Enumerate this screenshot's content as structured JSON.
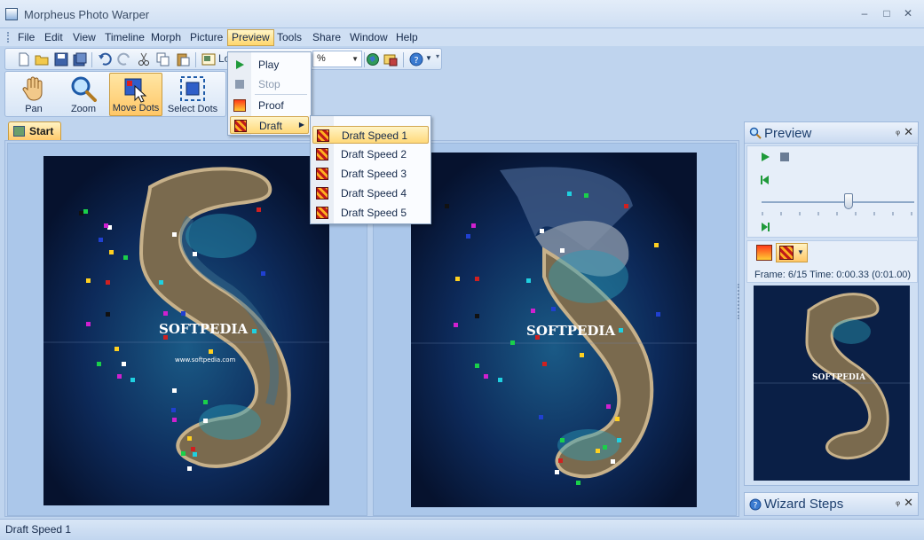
{
  "window": {
    "title": "Morpheus Photo Warper",
    "minimize": "–",
    "restore": "□",
    "close": "✕"
  },
  "menubar": {
    "items": [
      "File",
      "Edit",
      "View",
      "Timeline",
      "Morph",
      "Picture",
      "Preview",
      "Tools",
      "Share",
      "Window",
      "Help"
    ],
    "active": "Preview"
  },
  "toolbar": {
    "zoom_value": "%",
    "load_label": "Lo"
  },
  "bigbar": {
    "pan": "Pan",
    "zoom": "Zoom",
    "move_dots": "Move Dots",
    "select_dots": "Select Dots"
  },
  "document_tab": {
    "label": "Start"
  },
  "preview_menu": {
    "items": [
      {
        "label": "Play",
        "disabled": false
      },
      {
        "label": "Stop",
        "disabled": true
      },
      {
        "label": "Proof",
        "disabled": false
      },
      {
        "label": "Draft",
        "disabled": false,
        "has_submenu": true
      }
    ]
  },
  "draft_submenu": {
    "items": [
      "Draft Speed 1",
      "Draft Speed 2",
      "Draft Speed 3",
      "Draft Speed 4",
      "Draft Speed 5"
    ],
    "highlighted": "Draft Speed 1"
  },
  "preview_panel": {
    "title": "Preview",
    "pin": "ᵩ",
    "close": "✕",
    "frame_info": "Frame: 6/15 Time: 0:00.33 (0:01.00)",
    "slider_fraction": 0.57
  },
  "wizard_panel": {
    "title": "Wizard Steps",
    "pin": "ᵩ",
    "close": "✕"
  },
  "photo": {
    "watermark": "SOFTPEDIA",
    "url": "www.softpedia.com"
  },
  "status": {
    "text": "Draft Speed 1"
  },
  "colors": {
    "accent": "#ffd66b",
    "frame": "#bfd4ee",
    "photo_bg": "#081a3a"
  }
}
